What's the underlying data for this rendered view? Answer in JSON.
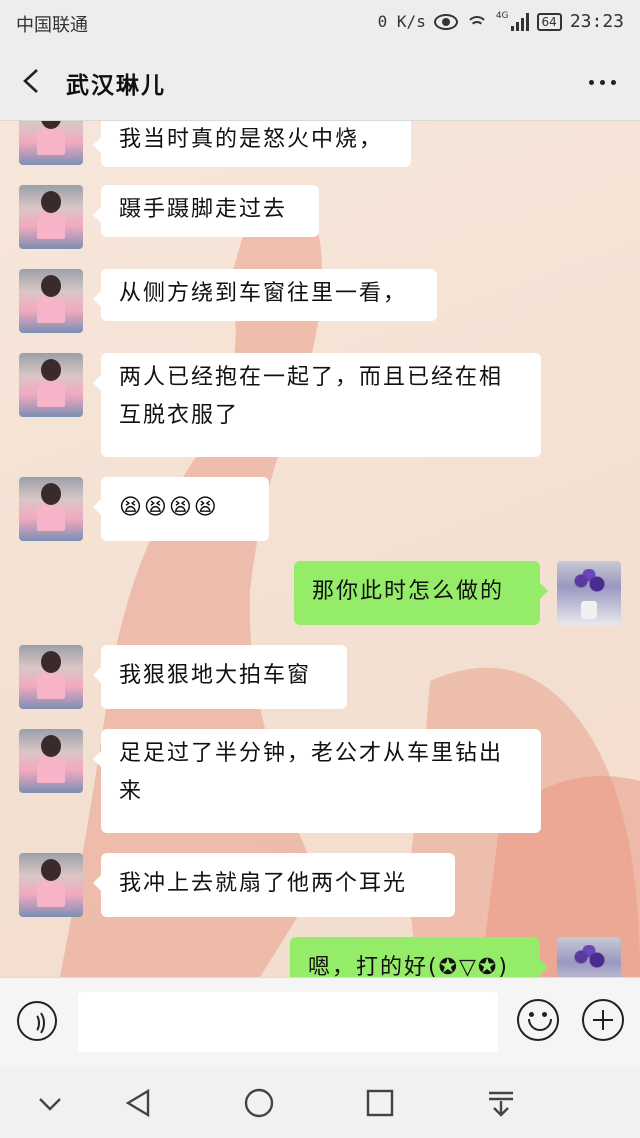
{
  "status_bar": {
    "carrier": "中国联通",
    "net_speed": "0 K/s",
    "network": "4G",
    "battery": "64",
    "time": "23:23"
  },
  "header": {
    "title": "武汉琳儿",
    "back_icon": "back-arrow-icon",
    "more_icon": "more-dots-icon"
  },
  "messages": [
    {
      "side": "in",
      "text": "我当时真的是怒火中烧，"
    },
    {
      "side": "in",
      "text": "蹑手蹑脚走过去"
    },
    {
      "side": "in",
      "text": "从侧方绕到车窗往里一看，"
    },
    {
      "side": "in",
      "text": "两人已经抱在一起了，而且已经在相互脱衣服了"
    },
    {
      "side": "in",
      "text": "😫😫😫😫"
    },
    {
      "side": "out",
      "text": "那你此时怎么做的"
    },
    {
      "side": "in",
      "text": "我狠狠地大拍车窗"
    },
    {
      "side": "in",
      "text": "足足过了半分钟，老公才从车里钻出来"
    },
    {
      "side": "in",
      "text": "我冲上去就扇了他两个耳光"
    },
    {
      "side": "out",
      "text": "嗯，打的好(✪▽✪)"
    }
  ],
  "input_bar": {
    "voice_icon": "voice-icon",
    "text_value": "",
    "emoji_icon": "emoji-icon",
    "plus_icon": "plus-icon"
  },
  "nav_bar": {
    "items": [
      "collapse-icon",
      "back-triangle-icon",
      "home-circle-icon",
      "recents-square-icon",
      "notification-pull-icon"
    ]
  },
  "colors": {
    "out_bubble": "#95ec69",
    "in_bubble": "#ffffff",
    "header_bg": "#ededed"
  }
}
